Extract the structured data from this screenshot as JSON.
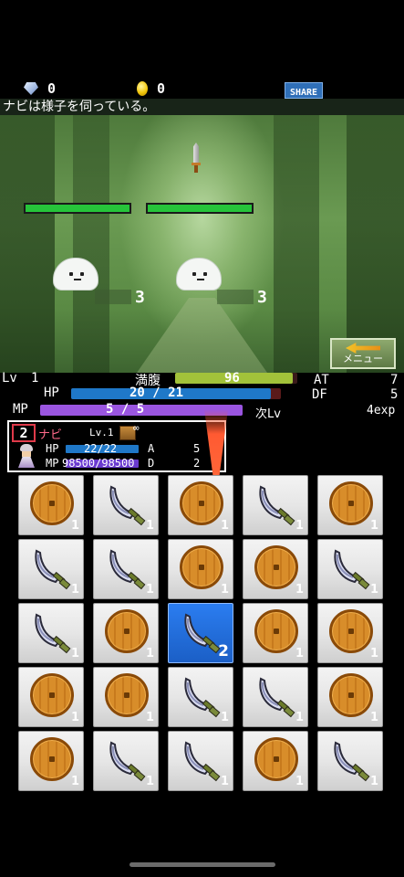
{
  "topbar": {
    "gems": "0",
    "coins": "0",
    "share_label": "SHARE"
  },
  "message": "ナビは様子を伺っている。",
  "battle": {
    "enemies": [
      {
        "level": "3",
        "hp_fraction": 1.0
      },
      {
        "level": "3",
        "hp_fraction": 1.0
      }
    ],
    "menu_label": "メニュー"
  },
  "status": {
    "lv_label": "Lv",
    "lv_value": "1",
    "satiety_label": "満腹",
    "satiety_value": "96",
    "satiety_fraction": 0.96,
    "hp_label": "HP",
    "hp_value": "20 / 21",
    "hp_fraction": 0.95,
    "mp_label": "MP",
    "mp_value": "5 / 5",
    "mp_fraction": 1.0,
    "at_label": "AT",
    "at_value": "7",
    "df_label": "DF",
    "df_value": "5",
    "next_label": "次Lv",
    "next_value": "4exp"
  },
  "character": {
    "slot": "2",
    "name": "ナビ",
    "level": "Lv.1",
    "infinity": "∞",
    "hp_label": "HP",
    "hp_value": "22/22",
    "mp_label": "MP",
    "mp_value": "98500/98500",
    "a_label": "A",
    "a_value": "5",
    "d_label": "D",
    "d_value": "2"
  },
  "inventory": {
    "rows": [
      [
        {
          "item": "shield",
          "count": "1"
        },
        {
          "item": "sword",
          "count": "1"
        },
        {
          "item": "shield",
          "count": "1"
        },
        {
          "item": "sword",
          "count": "1"
        },
        {
          "item": "shield",
          "count": "1"
        }
      ],
      [
        {
          "item": "sword",
          "count": "1"
        },
        {
          "item": "sword",
          "count": "1"
        },
        {
          "item": "shield",
          "count": "1"
        },
        {
          "item": "shield",
          "count": "1"
        },
        {
          "item": "sword",
          "count": "1"
        }
      ],
      [
        {
          "item": "sword",
          "count": "1"
        },
        {
          "item": "shield",
          "count": "1"
        },
        {
          "item": "sword",
          "count": "2",
          "selected": true
        },
        {
          "item": "shield",
          "count": "1"
        },
        {
          "item": "shield",
          "count": "1"
        }
      ],
      [
        {
          "item": "shield",
          "count": "1"
        },
        {
          "item": "shield",
          "count": "1"
        },
        {
          "item": "sword",
          "count": "1"
        },
        {
          "item": "sword",
          "count": "1"
        },
        {
          "item": "shield",
          "count": "1"
        }
      ],
      [
        {
          "item": "shield",
          "count": "1"
        },
        {
          "item": "sword",
          "count": "1"
        },
        {
          "item": "sword",
          "count": "1"
        },
        {
          "item": "shield",
          "count": "1"
        },
        {
          "item": "sword",
          "count": "1"
        }
      ]
    ]
  },
  "colors": {
    "hp_bar": "#1f78c8",
    "mp_bar": "#9a55e0",
    "satiety_bar": "#a2c23a",
    "enemy_hp": "#26c43a",
    "selected_tile": "#2b7df0"
  }
}
